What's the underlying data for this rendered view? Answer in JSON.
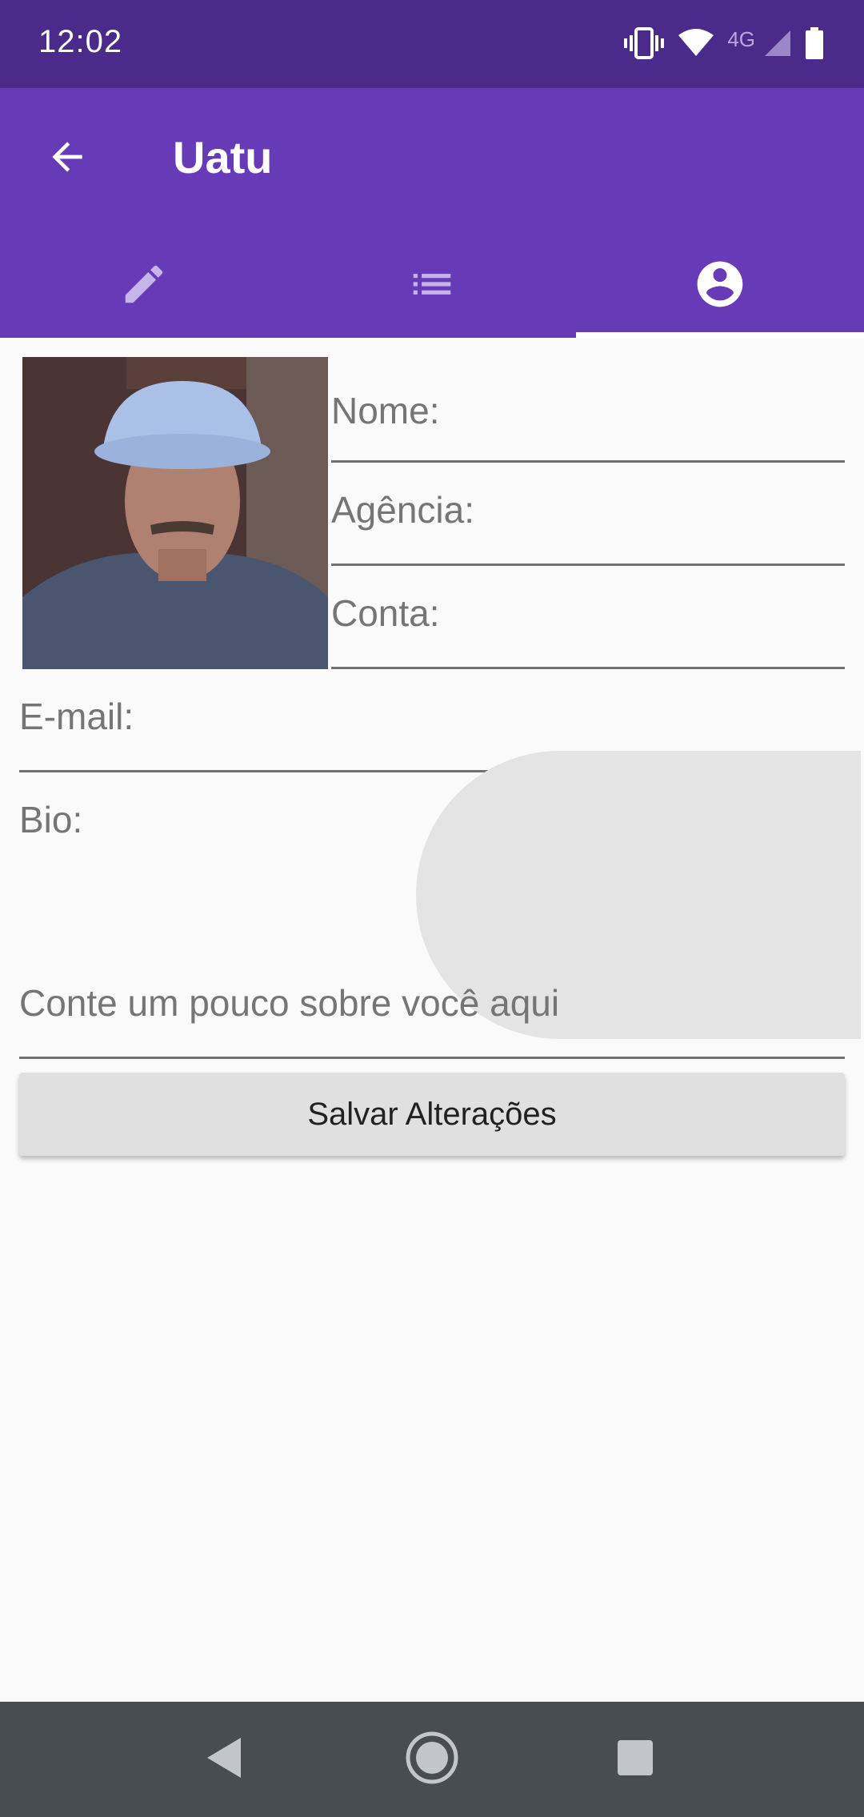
{
  "status_bar": {
    "time": "12:02",
    "network_label": "4G",
    "icons": [
      "vibrate-icon",
      "wifi-icon",
      "signal-icon",
      "battery-icon"
    ]
  },
  "app_bar": {
    "title": "Uatu",
    "back_icon": "arrow-back-icon",
    "background_color": "#673ab7",
    "status_color": "#4a2b8a"
  },
  "tabs": [
    {
      "icon": "pencil-icon",
      "active": false
    },
    {
      "icon": "list-icon",
      "active": false
    },
    {
      "icon": "account-circle-icon",
      "active": true
    }
  ],
  "form": {
    "name_label": "Nome:",
    "agency_label": "Agência:",
    "account_label": "Conta:",
    "email_label": "E-mail:",
    "bio_label": "Bio:",
    "bio_placeholder": "Conte um pouco sobre você aqui",
    "save_label": "Salvar Alterações"
  },
  "nav_bar": {
    "icons": [
      "back-triangle-icon",
      "home-circle-icon",
      "recents-square-icon"
    ]
  }
}
